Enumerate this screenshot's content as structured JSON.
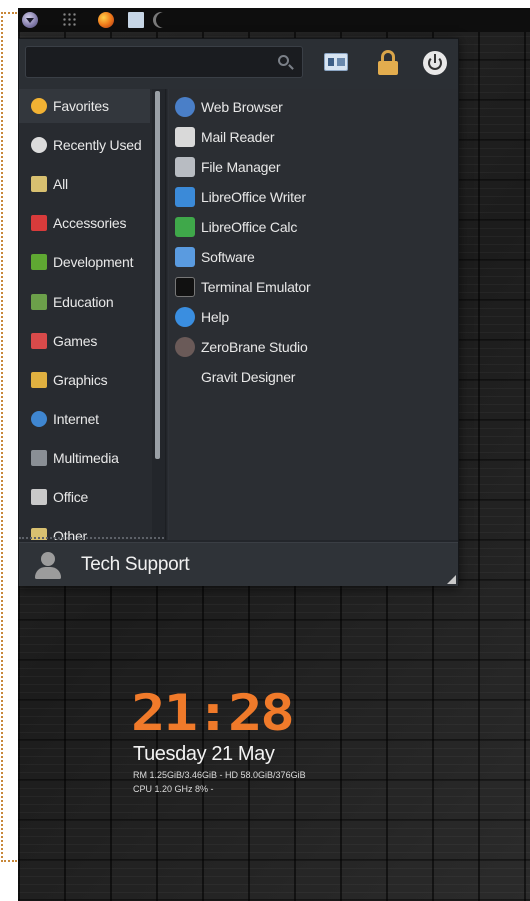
{
  "panel": {
    "icons": [
      "menu-launcher-icon",
      "apps-grid-icon",
      "firefox-icon",
      "window-icon",
      "moon-icon"
    ]
  },
  "menu": {
    "search": {
      "value": "",
      "placeholder": ""
    },
    "categories": [
      {
        "label": "Favorites",
        "icon": "star-icon",
        "color": "#f2b233"
      },
      {
        "label": "Recently Used",
        "icon": "recent-icon",
        "color": "#dcdcdc"
      },
      {
        "label": "All",
        "icon": "all-icon",
        "color": "#d8c070"
      },
      {
        "label": "Accessories",
        "icon": "accessories-icon",
        "color": "#d83b3b"
      },
      {
        "label": "Development",
        "icon": "development-icon",
        "color": "#5fa832"
      },
      {
        "label": "Education",
        "icon": "education-icon",
        "color": "#6ca04a"
      },
      {
        "label": "Games",
        "icon": "games-icon",
        "color": "#d84a4a"
      },
      {
        "label": "Graphics",
        "icon": "graphics-icon",
        "color": "#e0b040"
      },
      {
        "label": "Internet",
        "icon": "internet-icon",
        "color": "#3f86d0"
      },
      {
        "label": "Multimedia",
        "icon": "multimedia-icon",
        "color": "#8a8f95"
      },
      {
        "label": "Office",
        "icon": "office-icon",
        "color": "#c9c9c9"
      },
      {
        "label": "Other",
        "icon": "other-icon",
        "color": "#d8c070"
      }
    ],
    "apps": [
      {
        "label": "Web Browser",
        "icon": "web-browser-icon",
        "color": "#4a7fc8"
      },
      {
        "label": "Mail Reader",
        "icon": "mail-reader-icon",
        "color": "#d9d9d9"
      },
      {
        "label": "File Manager",
        "icon": "file-manager-icon",
        "color": "#b8bcc2"
      },
      {
        "label": "LibreOffice Writer",
        "icon": "writer-icon",
        "color": "#3b8ad8"
      },
      {
        "label": "LibreOffice Calc",
        "icon": "calc-icon",
        "color": "#3fa84a"
      },
      {
        "label": "Software",
        "icon": "software-icon",
        "color": "#5a9be0"
      },
      {
        "label": "Terminal Emulator",
        "icon": "terminal-icon",
        "color": "#111111"
      },
      {
        "label": "Help",
        "icon": "help-icon",
        "color": "#3a8ee0"
      },
      {
        "label": "ZeroBrane Studio",
        "icon": "zerobrane-icon",
        "color": "#6a5a58"
      },
      {
        "label": "Gravit Designer",
        "icon": "",
        "color": ""
      }
    ],
    "footer": {
      "user_name": "Tech Support"
    }
  },
  "conky": {
    "time": "21:28",
    "date": "Tuesday 21 May",
    "ram_line": "RM 1.25GiB/3.46GiB - HD 58.0GiB/376GiB",
    "cpu_line": "CPU 1.20 GHz 8% -"
  },
  "colors": {
    "accent": "#f07a2a",
    "menu_bg": "#23262b"
  }
}
